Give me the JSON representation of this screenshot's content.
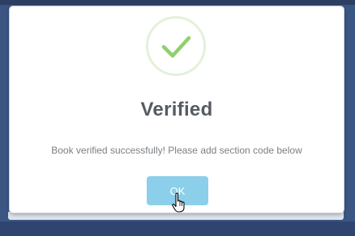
{
  "dialog": {
    "title": "Verified",
    "message": "Book verified successfully! Please add section code below",
    "ok_label": "OK",
    "success_icon": "check-icon",
    "success_color": "#8fd16a"
  },
  "colors": {
    "button": "#8ccfea",
    "backdrop": "#3c5683"
  }
}
